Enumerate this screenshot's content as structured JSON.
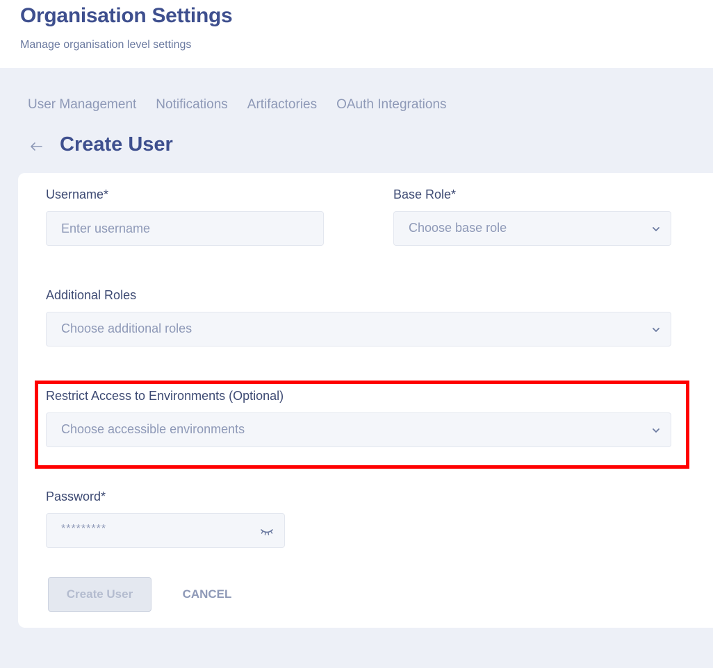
{
  "page": {
    "title": "Organisation Settings",
    "subtitle": "Manage organisation level settings"
  },
  "tabs": [
    {
      "label": "User Management"
    },
    {
      "label": "Notifications"
    },
    {
      "label": "Artifactories"
    },
    {
      "label": "OAuth Integrations"
    }
  ],
  "form": {
    "title": "Create User",
    "username": {
      "label": "Username*",
      "placeholder": "Enter username"
    },
    "base_role": {
      "label": "Base Role*",
      "placeholder": "Choose base role"
    },
    "additional_roles": {
      "label": "Additional Roles",
      "placeholder": "Choose additional roles"
    },
    "environments": {
      "label": "Restrict Access to Environments (Optional)",
      "placeholder": "Choose accessible environments"
    },
    "password": {
      "label": "Password*",
      "value": "*********"
    },
    "submit_label": "Create User",
    "cancel_label": "CANCEL"
  },
  "icons": {
    "back": "arrow-left-icon",
    "dropdown": "chevron-down-icon",
    "password_toggle": "eye-closed-icon"
  },
  "colors": {
    "accent": "#3e4f8e",
    "background": "#edf0f7",
    "highlight": "#ff0000"
  }
}
